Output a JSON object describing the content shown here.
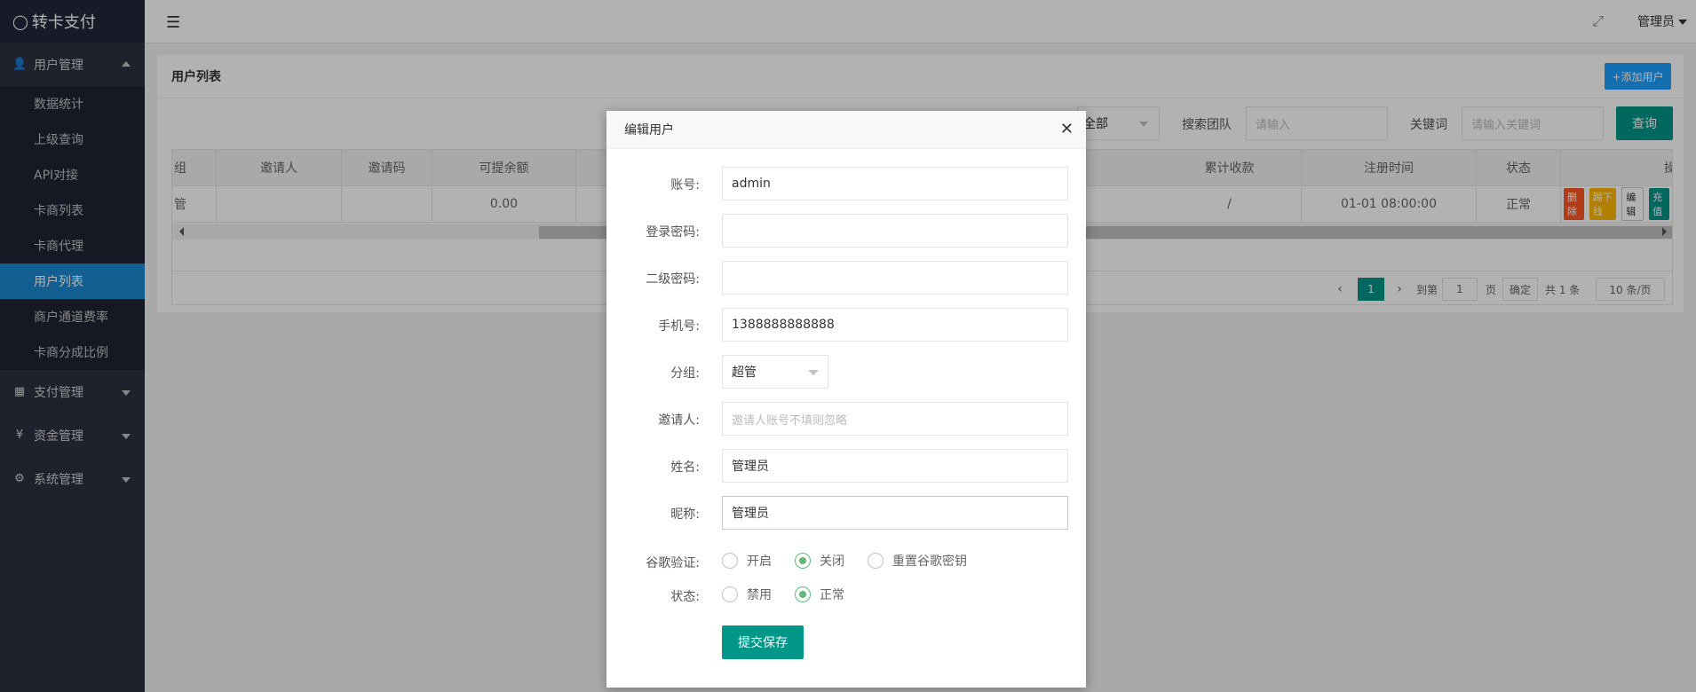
{
  "app": {
    "logo_text": "转卡支付",
    "logo_icon": "fire-icon"
  },
  "sidebar": {
    "groups": [
      {
        "label": "用户管理",
        "icon": "users-icon",
        "open": true
      },
      {
        "label": "支付管理",
        "icon": "payment-icon"
      },
      {
        "label": "资金管理",
        "icon": "yen-icon"
      },
      {
        "label": "系统管理",
        "icon": "gear-icon"
      }
    ],
    "sub_items": [
      "数据统计",
      "上级查询",
      "API对接",
      "卡商列表",
      "卡商代理",
      "用户列表",
      "商户通道费率",
      "卡商分成比例"
    ],
    "active_item": "用户列表"
  },
  "header": {
    "user": "管理员",
    "menu_icon": "menu-icon",
    "fullscreen_icon": "fullscreen-icon"
  },
  "page": {
    "title": "用户列表",
    "add_button": "+添加用户",
    "filter_select": "全部",
    "search_team_label": "搜索团队",
    "search_team_placeholder": "请输入",
    "keyword_label": "关键词",
    "keyword_placeholder": "请输入关键词",
    "query_button": "查询"
  },
  "table": {
    "headers": [
      "组",
      "邀请人",
      "邀请码",
      "可提余额",
      "累计收款",
      "注册时间",
      "状态",
      "操作"
    ],
    "row": {
      "group": "管",
      "inviter": "",
      "invite_code": "",
      "balance": "0.00",
      "total": "/",
      "reg_time": "01-01 08:00:00",
      "status": "正常"
    },
    "actions": [
      {
        "label": "删除",
        "color": "#ff5722"
      },
      {
        "label": "踢下线",
        "color": "#ffb800"
      },
      {
        "label": "编辑",
        "color": "#ffffff"
      },
      {
        "label": "充值",
        "color": "#009688"
      }
    ]
  },
  "pagination": {
    "current": "1",
    "goto_label": "到第",
    "goto_value": "1",
    "page_label": "页",
    "confirm": "确定",
    "total": "共 1 条",
    "per_page": "10 条/页"
  },
  "modal": {
    "title": "编辑用户",
    "fields": {
      "account_label": "账号:",
      "account_value": "admin",
      "password_label": "登录密码:",
      "password_value": "",
      "second_password_label": "二级密码:",
      "second_password_value": "",
      "phone_label": "手机号:",
      "phone_value": "1388888888888",
      "group_label": "分组:",
      "group_value": "超管",
      "inviter_label": "邀请人:",
      "inviter_placeholder": "邀请人账号不填则忽略",
      "name_label": "姓名:",
      "name_value": "管理员",
      "nickname_label": "昵称:",
      "nickname_value": "管理员"
    },
    "google_auth": {
      "label": "谷歌验证:",
      "options": [
        "开启",
        "关闭",
        "重置谷歌密钥"
      ],
      "selected": "关闭"
    },
    "status": {
      "label": "状态:",
      "options": [
        "禁用",
        "正常"
      ],
      "selected": "正常"
    },
    "submit": "提交保存"
  }
}
